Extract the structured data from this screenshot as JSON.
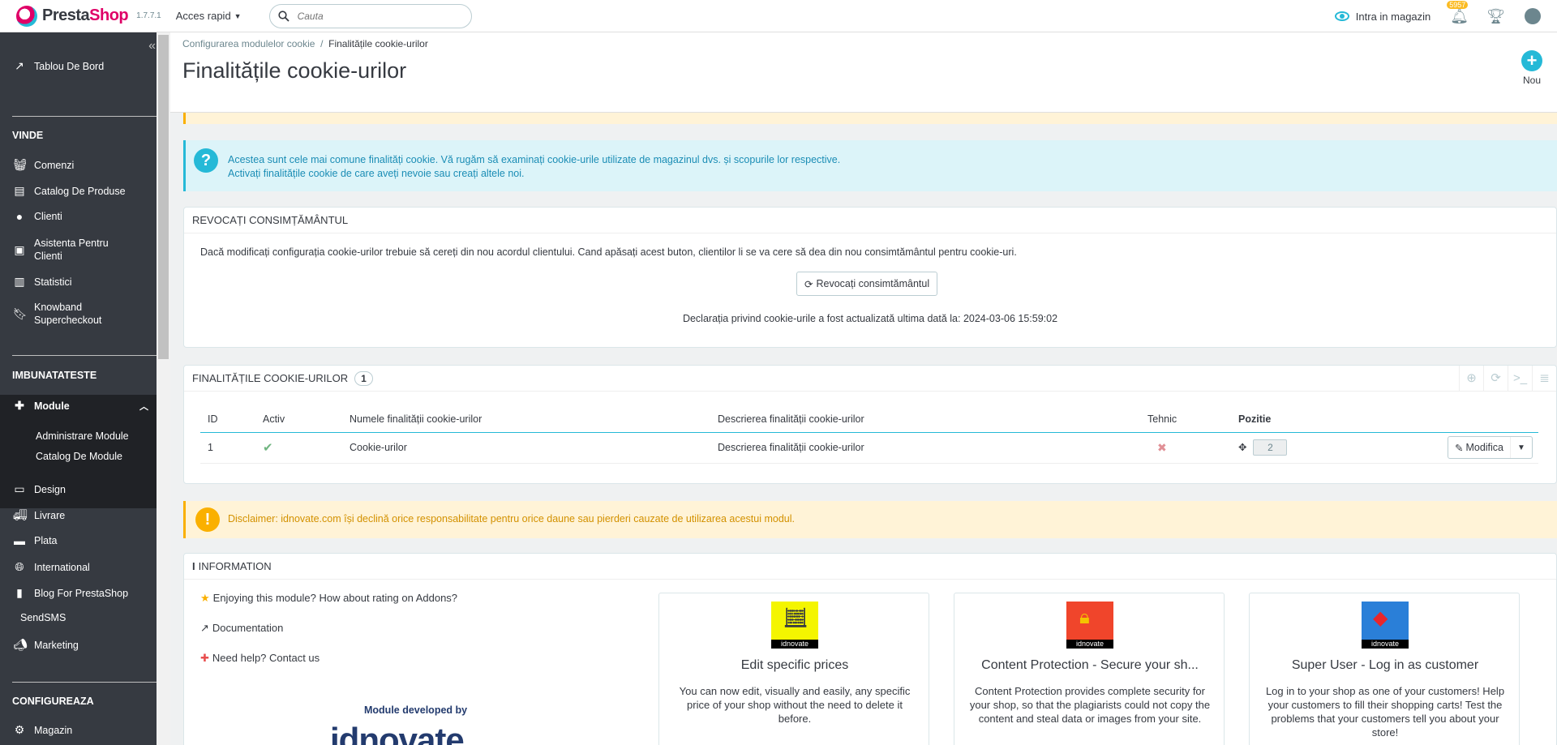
{
  "header": {
    "logo_text_a": "Presta",
    "logo_text_b": "Shop",
    "version": "1.7.7.1",
    "quick_access": "Acces rapid",
    "search_placeholder": "Cauta",
    "view_shop": "Intra in magazin",
    "notifications_count": "5957",
    "accent_color": "#25b9d7"
  },
  "sidebar": {
    "dashboard": "Tablou De Bord",
    "sell_section": "VINDE",
    "orders": "Comenzi",
    "catalog": "Catalog De Produse",
    "customers": "Clienti",
    "support_line1": "Asistenta Pentru",
    "support_line2": "Clienti",
    "stats": "Statistici",
    "knowband_line1": "Knowband",
    "knowband_line2": "Supercheckout",
    "improve_section": "IMBUNATATESTE",
    "modules": "Module",
    "modules_manager": "Administrare Module",
    "modules_catalog": "Catalog De Module",
    "design": "Design",
    "shipping": "Livrare",
    "payment": "Plata",
    "international": "International",
    "blog": "Blog For PrestaShop",
    "sendsms": "SendSMS",
    "marketing": "Marketing",
    "configure_section": "CONFIGUREAZA",
    "shop": "Magazin"
  },
  "page": {
    "breadcrumb_parent": "Configurarea modulelor cookie",
    "breadcrumb_sep": "/",
    "breadcrumb_current": "Finalitățile cookie-urilor",
    "title": "Finalitățile cookie-urilor",
    "new_label": "Nou"
  },
  "info_alert": {
    "line1": "Acestea sunt cele mai comune finalități cookie. Vă rugăm să examinați cookie-urile utilizate de magazinul dvs. și scopurile lor respective.",
    "line2": "Activați finalitățile cookie de care aveți nevoie sau creați altele noi."
  },
  "revoke_panel": {
    "heading": "REVOCAȚI CONSIMȚĂMÂNTUL",
    "text": "Dacă modificați configurația cookie-urilor trebuie să cereți din nou acordul clientului. Cand apăsați acest buton, clientilor li se va cere să dea din nou consimtământul pentru cookie-uri.",
    "button": "Revocați consimtământul",
    "updated": "Declarația privind cookie-urile a fost actualizată ultima dată la: 2024-03-06 15:59:02"
  },
  "list_panel": {
    "heading": "FINALITĂȚILE COOKIE-URILOR",
    "count": "1",
    "columns": [
      "ID",
      "Activ",
      "Numele finalității cookie-urilor",
      "Descrierea finalității cookie-urilor",
      "Tehnic",
      "Pozitie"
    ],
    "rows": [
      {
        "id": "1",
        "active": true,
        "name": "Cookie-urilor",
        "description": "Descrierea finalității cookie-urilor",
        "technical": false,
        "position": "2",
        "action": "Modifica"
      }
    ]
  },
  "disclaimer": "Disclaimer: idnovate.com își declină orice responsabilitate pentru orice daune sau pierderi cauzate de utilizarea acestui modul.",
  "information": {
    "heading": "INFORMATION",
    "rate": "Enjoying this module? How about rating on Addons?",
    "docs": "Documentation",
    "help": "Need help? Contact us",
    "developed_by": "Module developed by",
    "dev_logo": "idnovate",
    "cards": [
      {
        "title": "Edit specific prices",
        "desc": "You can now edit, visually and easily, any specific price of your shop without the need to delete it before.",
        "thumb_label": "idnovate",
        "thumb_color": "#f4f500"
      },
      {
        "title": "Content Protection - Secure your sh...",
        "desc": "Content Protection provides complete security for your shop, so that the plagiarists could not copy the content and steal data or images from your site.",
        "thumb_label": "idnovate",
        "thumb_color": "#f0452b"
      },
      {
        "title": "Super User - Log in as customer",
        "desc": "Log in to your shop as one of your customers! Help your customers to fill their shopping carts! Test the problems that your customers tell you about your store!",
        "thumb_label": "idnovate",
        "thumb_color": "#2a7fd8"
      }
    ]
  }
}
